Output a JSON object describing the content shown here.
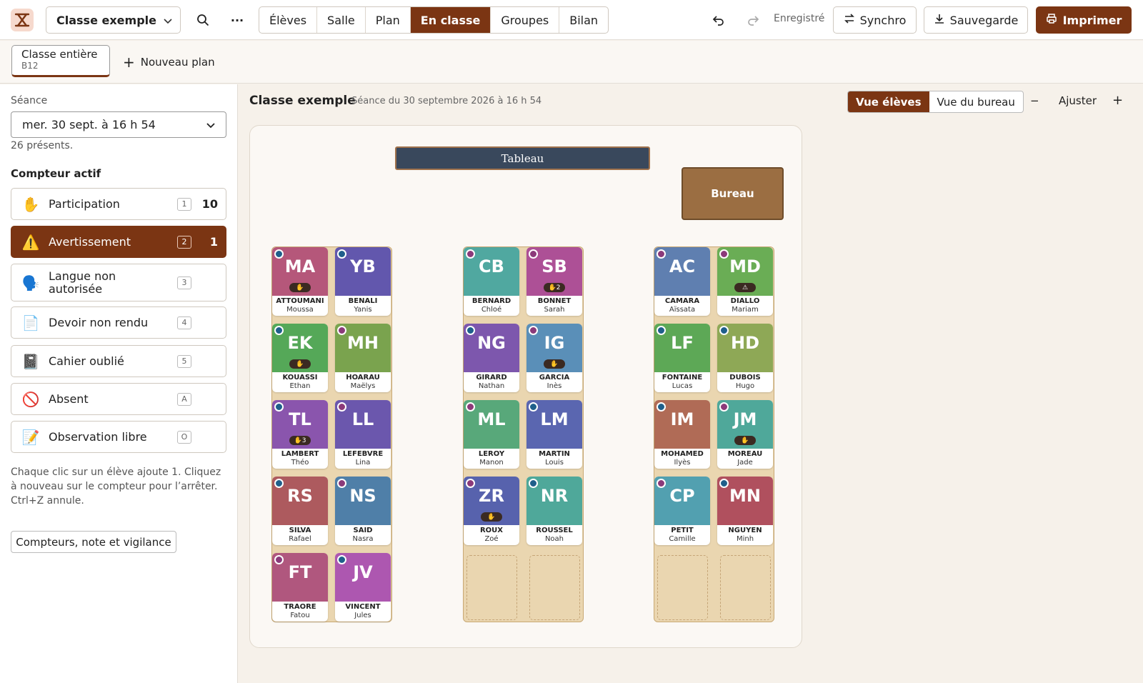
{
  "topbar": {
    "class_name": "Classe exemple",
    "tabs": [
      "Élèves",
      "Salle",
      "Plan",
      "En classe",
      "Groupes",
      "Bilan"
    ],
    "active_tab": "En classe",
    "saved": "Enregistré",
    "sync": "Synchro",
    "backup": "Sauvegarde",
    "print": "Imprimer"
  },
  "plans": {
    "current": "Classe entière",
    "current_sub": "B12",
    "new_plan": "Nouveau plan"
  },
  "sidebar": {
    "session_label": "Séance",
    "session_value": "mer. 30 sept. à 16 h 54",
    "present": "26 présents.",
    "counter_title": "Compteur actif",
    "counters": [
      {
        "icon": "raised-hand-icon",
        "glyph": "✋",
        "name": "Participation",
        "key": "1",
        "count": "10"
      },
      {
        "icon": "warning-icon",
        "glyph": "⚠️",
        "name": "Avertissement",
        "key": "2",
        "count": "1"
      },
      {
        "icon": "speaking-head-icon",
        "glyph": "🗣️",
        "name": "Langue non autorisée",
        "key": "3",
        "count": ""
      },
      {
        "icon": "page-icon",
        "glyph": "📄",
        "name": "Devoir non rendu",
        "key": "4",
        "count": ""
      },
      {
        "icon": "notebook-icon",
        "glyph": "📓",
        "name": "Cahier oublié",
        "key": "5",
        "count": ""
      },
      {
        "icon": "prohibited-icon",
        "glyph": "🚫",
        "name": "Absent",
        "key": "A",
        "count": ""
      },
      {
        "icon": "memo-icon",
        "glyph": "📝",
        "name": "Observation libre",
        "key": "O",
        "count": ""
      }
    ],
    "help": "Chaque clic sur un élève ajoute 1. Cliquez à nouveau sur le compteur pour l’arrêter. Ctrl+Z annule.",
    "extra_button": "Compteurs, note et vigilance"
  },
  "canvas": {
    "title": "Classe exemple",
    "subtitle": "Séance du 30 septembre 2026 à 16 h 54",
    "view_students": "Vue élèves",
    "view_desk": "Vue du bureau",
    "zoom_out": "−",
    "fit": "Ajuster",
    "zoom_in": "+",
    "board": "Tableau",
    "desk": "Bureau"
  },
  "colors": {
    "accent": "#7b3513",
    "dot_blue": "#1f5f8b",
    "dot_purple": "#8b3a7a"
  },
  "students": [
    {
      "ini": "MA",
      "last": "ATTOUMANI",
      "first": "Moussa",
      "color": "#b5577a",
      "dot": "blue",
      "badge": "✋"
    },
    {
      "ini": "YB",
      "last": "BENALI",
      "first": "Yanis",
      "color": "#6257ad",
      "dot": "blue",
      "badge": ""
    },
    {
      "ini": "CB",
      "last": "BERNARD",
      "first": "Chloé",
      "color": "#50a8a0",
      "dot": "purple",
      "badge": ""
    },
    {
      "ini": "SB",
      "last": "BONNET",
      "first": "Sarah",
      "color": "#ad5096",
      "dot": "purple",
      "badge": "✋2"
    },
    {
      "ini": "AC",
      "last": "CAMARA",
      "first": "Aïssata",
      "color": "#5f7fb0",
      "dot": "purple",
      "badge": ""
    },
    {
      "ini": "MD",
      "last": "DIALLO",
      "first": "Mariam",
      "color": "#6aad55",
      "dot": "purple",
      "badge": "⚠"
    },
    {
      "ini": "EK",
      "last": "KOUASSI",
      "first": "Ethan",
      "color": "#55a858",
      "dot": "blue",
      "badge": "✋"
    },
    {
      "ini": "MH",
      "last": "HOARAU",
      "first": "Maëlys",
      "color": "#7aa34e",
      "dot": "purple",
      "badge": ""
    },
    {
      "ini": "NG",
      "last": "GIRARD",
      "first": "Nathan",
      "color": "#7d57ad",
      "dot": "blue",
      "badge": ""
    },
    {
      "ini": "IG",
      "last": "GARCIA",
      "first": "Inès",
      "color": "#5a8fb8",
      "dot": "purple",
      "badge": "✋"
    },
    {
      "ini": "LF",
      "last": "FONTAINE",
      "first": "Lucas",
      "color": "#5da856",
      "dot": "blue",
      "badge": ""
    },
    {
      "ini": "HD",
      "last": "DUBOIS",
      "first": "Hugo",
      "color": "#8ea856",
      "dot": "blue",
      "badge": ""
    },
    {
      "ini": "TL",
      "last": "LAMBERT",
      "first": "Théo",
      "color": "#8a55ad",
      "dot": "blue",
      "badge": "✋3"
    },
    {
      "ini": "LL",
      "last": "LEFEBVRE",
      "first": "Lina",
      "color": "#6b57ad",
      "dot": "purple",
      "badge": ""
    },
    {
      "ini": "ML",
      "last": "LEROY",
      "first": "Manon",
      "color": "#58a87a",
      "dot": "purple",
      "badge": ""
    },
    {
      "ini": "LM",
      "last": "MARTIN",
      "first": "Louis",
      "color": "#5a66b0",
      "dot": "blue",
      "badge": ""
    },
    {
      "ini": "IM",
      "last": "MOHAMED",
      "first": "Ilyès",
      "color": "#b06b56",
      "dot": "blue",
      "badge": ""
    },
    {
      "ini": "JM",
      "last": "MOREAU",
      "first": "Jade",
      "color": "#4fa89a",
      "dot": "purple",
      "badge": "✋"
    },
    {
      "ini": "RS",
      "last": "SILVA",
      "first": "Rafael",
      "color": "#ad5a5e",
      "dot": "blue",
      "badge": ""
    },
    {
      "ini": "NS",
      "last": "SAID",
      "first": "Nasra",
      "color": "#4f7fa8",
      "dot": "purple",
      "badge": ""
    },
    {
      "ini": "ZR",
      "last": "ROUX",
      "first": "Zoé",
      "color": "#5762ad",
      "dot": "purple",
      "badge": "✋"
    },
    {
      "ini": "NR",
      "last": "ROUSSEL",
      "first": "Noah",
      "color": "#4fa89a",
      "dot": "blue",
      "badge": ""
    },
    {
      "ini": "CP",
      "last": "PETIT",
      "first": "Camille",
      "color": "#52a0b0",
      "dot": "purple",
      "badge": ""
    },
    {
      "ini": "MN",
      "last": "NGUYEN",
      "first": "Minh",
      "color": "#b0505e",
      "dot": "blue",
      "badge": ""
    },
    {
      "ini": "FT",
      "last": "TRAORE",
      "first": "Fatou",
      "color": "#b0577e",
      "dot": "purple",
      "badge": ""
    },
    {
      "ini": "JV",
      "last": "VINCENT",
      "first": "Jules",
      "color": "#ad57b0",
      "dot": "blue",
      "badge": ""
    }
  ]
}
